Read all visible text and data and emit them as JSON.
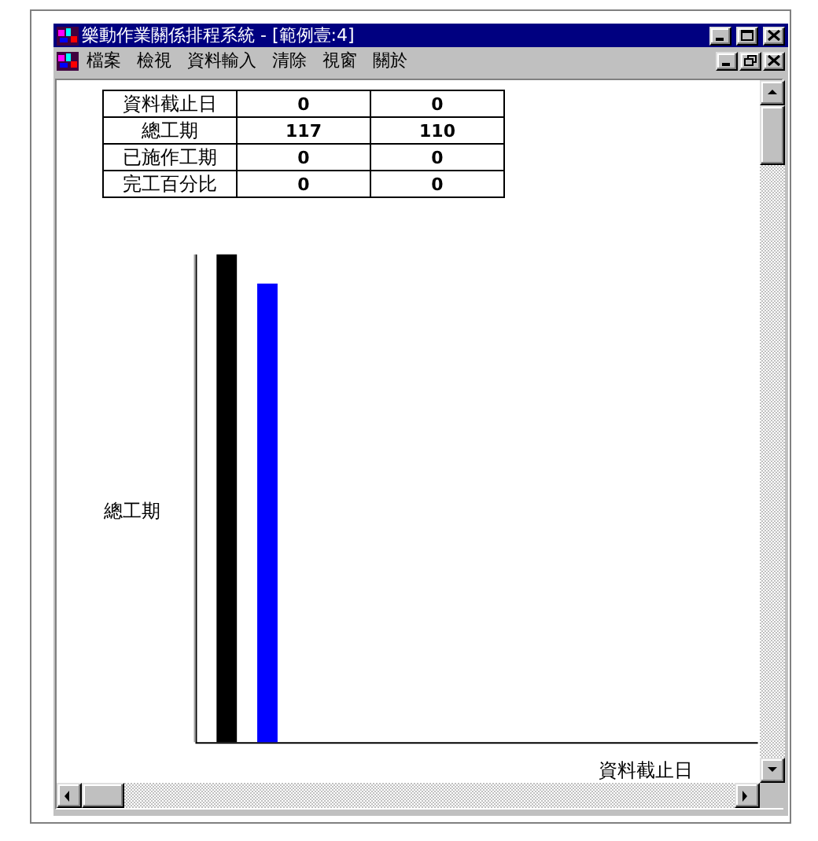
{
  "window": {
    "title": "樂動作業關係排程系統 - [範例壹:4]"
  },
  "menu": [
    "檔案",
    "檢視",
    "資料輸入",
    "清除",
    "視窗",
    "關於"
  ],
  "table": {
    "rows": [
      {
        "label": "資料截止日",
        "cells": [
          "0",
          "0"
        ]
      },
      {
        "label": "總工期",
        "cells": [
          "117",
          "110"
        ]
      },
      {
        "label": "已施作工期",
        "cells": [
          "0",
          "0"
        ]
      },
      {
        "label": "完工百分比",
        "cells": [
          "0",
          "0"
        ]
      }
    ]
  },
  "chart": {
    "ylabel": "總工期",
    "xlabel": "資料截止日",
    "bars": [
      {
        "color": "#000000"
      },
      {
        "color": "#0000ff"
      }
    ]
  }
}
